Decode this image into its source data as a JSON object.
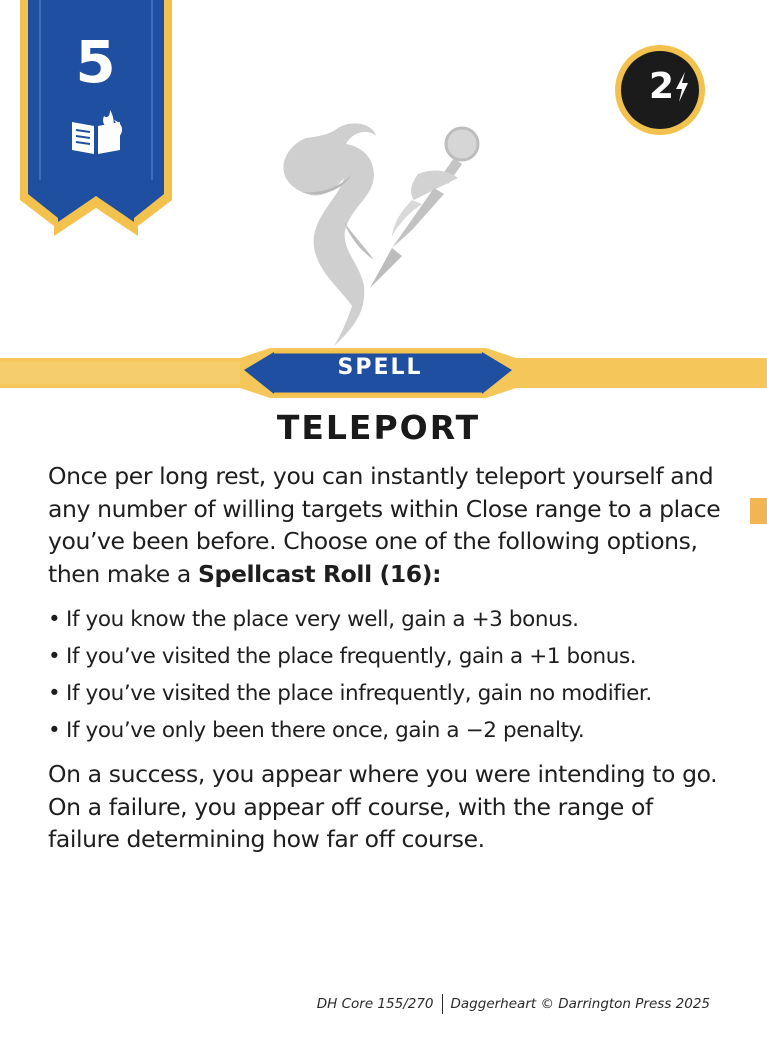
{
  "card": {
    "level": "5",
    "domain_icon": "codex-book-flame-icon",
    "recall_cost": "2",
    "recall_icon": "lightning-bolt-icon",
    "type": "SPELL",
    "title": "TELEPORT",
    "intro_part1": "Once per long rest, you can instantly teleport yourself and any number of willing targets within Close range to a place you’ve been before. Choose one of the following options, then make a ",
    "intro_bold": "Spellcast Roll (16)",
    "intro_end": ":",
    "bullet_char": "•",
    "options": [
      "If you know the place very well, gain a +3 bonus.",
      "If you’ve visited the place frequently, gain a +1 bonus.",
      "If you’ve visited the place infrequently, gain no modifier.",
      "If you’ve only been there once, gain a −2 penalty."
    ],
    "outcome": "On a success, you appear where you were intending to go. On a failure, you appear off course, with the range of failure determining how far off course."
  },
  "footer": {
    "card_number": "DH Core 155/270",
    "copyright": "Daggerheart © Darrington Press 2025"
  },
  "colors": {
    "banner_blue": "#1f4fa0",
    "gold": "#f2c14e",
    "stripe_gold": "#f5c65a",
    "recall_dark": "#1b1b1b",
    "art_gray": "#c9c9c9"
  }
}
